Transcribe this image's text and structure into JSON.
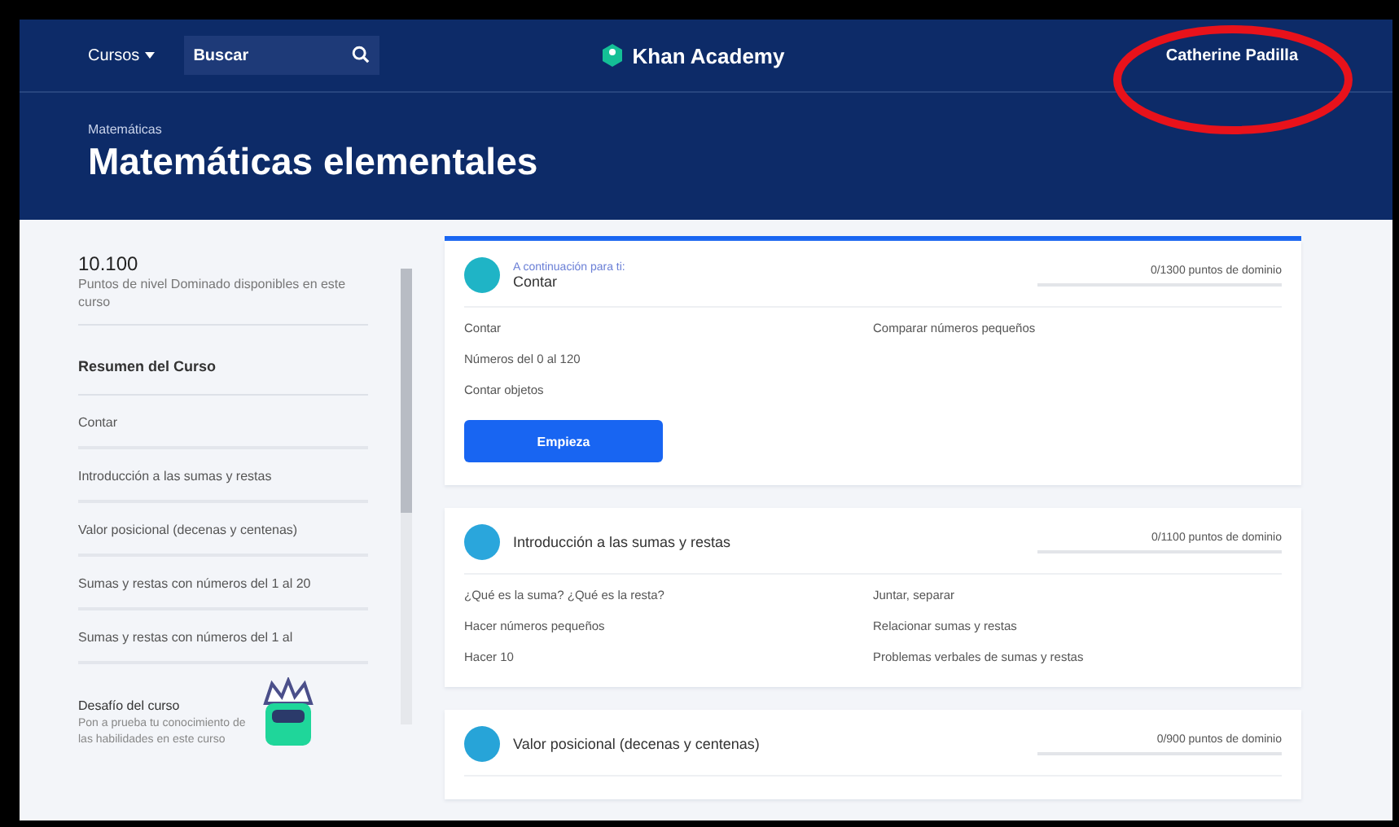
{
  "nav": {
    "courses": "Cursos",
    "search": {
      "placeholder": "Buscar"
    },
    "logo": "Khan Academy",
    "user": "Catherine Padilla"
  },
  "header": {
    "breadcrumb": "Matemáticas",
    "title": "Matemáticas elementales"
  },
  "sidebar": {
    "points": "10.100",
    "points_caption": "Puntos de nivel Dominado disponibles en este curso",
    "summary_title": "Resumen del Curso",
    "items": [
      {
        "label": "Contar"
      },
      {
        "label": "Introducción a las sumas y restas"
      },
      {
        "label": "Valor posicional (decenas y centenas)"
      },
      {
        "label": "Sumas y restas con números del 1 al 20"
      },
      {
        "label": "Sumas y restas con números del 1 al"
      }
    ],
    "challenge": {
      "title": "Desafío del curso",
      "text": "Pon a prueba tu conocimiento de las habilidades en este curso"
    }
  },
  "units": [
    {
      "kicker": "A continuación para ti:",
      "title": "Contar",
      "points": "0/1300 puntos de dominio",
      "left": [
        "Contar",
        "Números del 0 al 120",
        "Contar objetos"
      ],
      "right": [
        "Comparar números pequeños"
      ],
      "button": "Empieza"
    },
    {
      "title": "Introducción a las sumas y restas",
      "points": "0/1100 puntos de dominio",
      "left": [
        "¿Qué es la suma? ¿Qué es la resta?",
        "Hacer números pequeños",
        "Hacer 10"
      ],
      "right": [
        "Juntar, separar",
        "Relacionar sumas y restas",
        "Problemas verbales de sumas y restas"
      ]
    },
    {
      "title": "Valor posicional (decenas y centenas)",
      "points": "0/900 puntos de dominio"
    }
  ],
  "annotation": {
    "kind": "ellipse",
    "color": "#e8121b"
  }
}
